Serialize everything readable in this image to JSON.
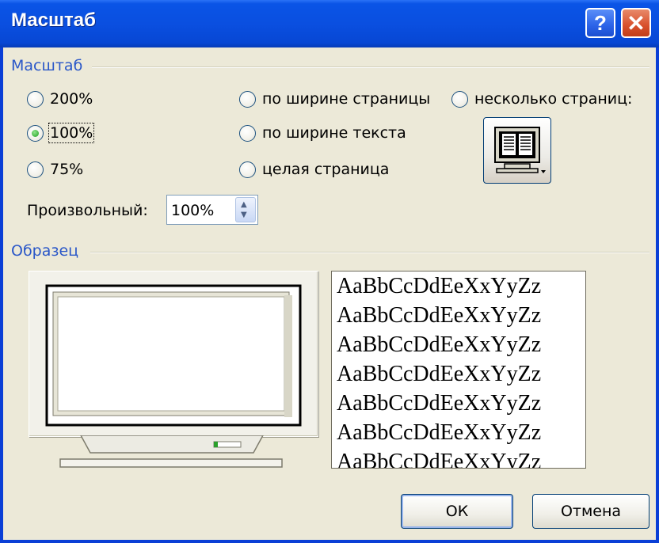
{
  "window": {
    "title": "Масштаб",
    "help": "?",
    "close": "✕"
  },
  "zoom_group": {
    "label": "Масштаб",
    "options": [
      {
        "label": "200%",
        "selected": false
      },
      {
        "label": "100%",
        "selected": true
      },
      {
        "label": "75%",
        "selected": false
      },
      {
        "label": "по ширине страницы",
        "selected": false
      },
      {
        "label": "по ширине текста",
        "selected": false
      },
      {
        "label": "целая страница",
        "selected": false
      },
      {
        "label": "несколько страниц:",
        "selected": false
      }
    ],
    "custom_label": "Произвольный:",
    "custom_value": "100%",
    "pages_button_icon": "multiple-pages-monitor-icon"
  },
  "sample_group": {
    "label": "Образец",
    "preview_icon": "monitor-preview",
    "sample_lines": [
      "AaBbCcDdEeXxYyZz",
      "AaBbCcDdEeXxYyZz",
      "AaBbCcDdEeXxYyZz",
      "AaBbCcDdEeXxYyZz",
      "AaBbCcDdEeXxYyZz",
      "AaBbCcDdEeXxYyZz",
      "AaBbCcDdEeXxYyZz"
    ]
  },
  "buttons": {
    "ok": "ОК",
    "cancel": "Отмена"
  },
  "colors": {
    "titlebar": "#0a4fe0",
    "group_label": "#2a57c8",
    "face": "#ece9d8",
    "radio_dot": "#21a121"
  }
}
